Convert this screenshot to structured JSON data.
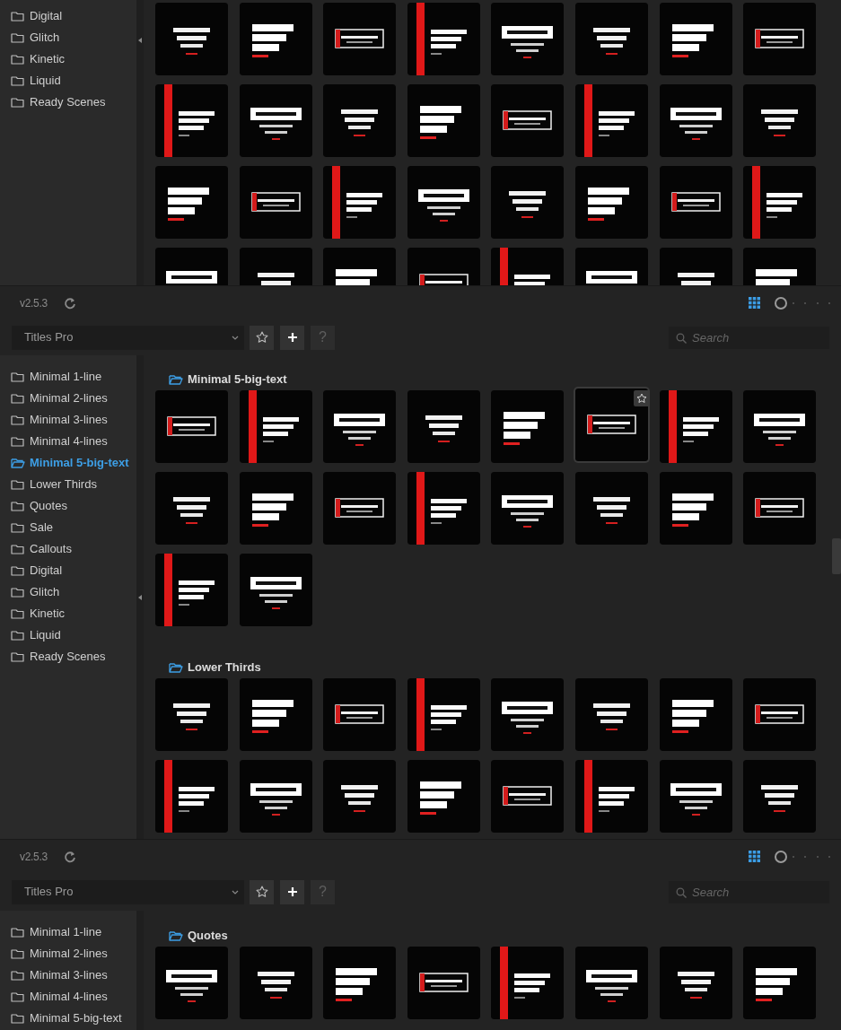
{
  "panels": [
    {
      "sidebar": {
        "items": [
          {
            "label": "Digital",
            "selected": false
          },
          {
            "label": "Glitch",
            "selected": false
          },
          {
            "label": "Kinetic",
            "selected": false
          },
          {
            "label": "Liquid",
            "selected": false
          },
          {
            "label": "Ready Scenes",
            "selected": false
          }
        ]
      },
      "sections": [
        {
          "thumbnails": [
            {
              "kind": "picture"
            },
            {
              "kind": "picture"
            },
            {
              "kind": "picture"
            },
            {
              "kind": "picture"
            },
            {
              "kind": "picture"
            },
            {
              "kind": "picture"
            },
            {
              "kind": "picture"
            },
            {
              "kind": "picture"
            },
            {
              "kind": "picture"
            },
            {
              "kind": "picture"
            },
            {
              "kind": "picture"
            },
            {
              "kind": "picture"
            },
            {
              "kind": "picture"
            },
            {
              "kind": "picture"
            },
            {
              "kind": "picture"
            },
            {
              "kind": "picture"
            },
            {
              "kind": "picture"
            },
            {
              "kind": "picture"
            },
            {
              "kind": "picture"
            },
            {
              "kind": "picture"
            },
            {
              "kind": "picture"
            },
            {
              "kind": "picture"
            },
            {
              "kind": "picture"
            },
            {
              "kind": "picture"
            },
            {
              "kind": "picture"
            },
            {
              "kind": "picture"
            },
            {
              "kind": "picture"
            },
            {
              "kind": "picture"
            },
            {
              "kind": "picture"
            },
            {
              "kind": "picture"
            },
            {
              "kind": "picture"
            },
            {
              "kind": "picture"
            }
          ]
        }
      ]
    },
    {
      "version": "v2.5.3",
      "size_slider": {
        "level": 0
      },
      "library": "Titles Pro",
      "help_label": "?",
      "search": {
        "placeholder": "Search"
      },
      "sidebar": {
        "items": [
          {
            "label": "Minimal 1-line",
            "selected": false
          },
          {
            "label": "Minimal 2-lines",
            "selected": false
          },
          {
            "label": "Minimal 3-lines",
            "selected": false
          },
          {
            "label": "Minimal 4-lines",
            "selected": false
          },
          {
            "label": "Minimal 5-big-text",
            "selected": true
          },
          {
            "label": "Lower Thirds",
            "selected": false
          },
          {
            "label": "Quotes",
            "selected": false
          },
          {
            "label": "Sale",
            "selected": false
          },
          {
            "label": "Callouts",
            "selected": false
          },
          {
            "label": "Digital",
            "selected": false
          },
          {
            "label": "Glitch",
            "selected": false
          },
          {
            "label": "Kinetic",
            "selected": false
          },
          {
            "label": "Liquid",
            "selected": false
          },
          {
            "label": "Ready Scenes",
            "selected": false
          }
        ]
      },
      "sections": [
        {
          "title": "Minimal 5-big-text",
          "thumbnails": [
            {
              "kind": "picture",
              "hovered": false
            },
            {
              "kind": "picture",
              "hovered": false
            },
            {
              "kind": "picture",
              "hovered": false
            },
            {
              "kind": "picture",
              "hovered": false
            },
            {
              "kind": "picture",
              "hovered": false
            },
            {
              "kind": "picture",
              "hovered": true
            },
            {
              "kind": "picture",
              "hovered": false
            },
            {
              "kind": "picture",
              "hovered": false
            },
            {
              "kind": "picture",
              "hovered": false
            },
            {
              "kind": "picture",
              "hovered": false
            },
            {
              "kind": "picture",
              "hovered": false
            },
            {
              "kind": "picture",
              "hovered": false
            },
            {
              "kind": "picture",
              "hovered": false
            },
            {
              "kind": "picture",
              "hovered": false
            },
            {
              "kind": "picture",
              "hovered": false
            },
            {
              "kind": "picture",
              "hovered": false
            },
            {
              "kind": "picture",
              "hovered": false
            },
            {
              "kind": "picture",
              "hovered": false
            }
          ]
        },
        {
          "title": "Lower Thirds",
          "thumbnails": [
            {
              "kind": "picture"
            },
            {
              "kind": "picture"
            },
            {
              "kind": "picture"
            },
            {
              "kind": "picture"
            },
            {
              "kind": "picture"
            },
            {
              "kind": "picture"
            },
            {
              "kind": "picture"
            },
            {
              "kind": "picture"
            },
            {
              "kind": "picture"
            },
            {
              "kind": "picture"
            },
            {
              "kind": "picture"
            },
            {
              "kind": "picture"
            },
            {
              "kind": "picture"
            },
            {
              "kind": "picture"
            },
            {
              "kind": "picture"
            },
            {
              "kind": "picture"
            }
          ]
        }
      ]
    },
    {
      "version": "v2.5.3",
      "size_slider": {
        "level": 0
      },
      "library": "Titles Pro",
      "help_label": "?",
      "search": {
        "placeholder": "Search"
      },
      "sidebar": {
        "items": [
          {
            "label": "Minimal 1-line",
            "selected": false
          },
          {
            "label": "Minimal 2-lines",
            "selected": false
          },
          {
            "label": "Minimal 3-lines",
            "selected": false
          },
          {
            "label": "Minimal 4-lines",
            "selected": false
          },
          {
            "label": "Minimal 5-big-text",
            "selected": false
          }
        ]
      },
      "sections": [
        {
          "title": "Quotes",
          "thumbnails": [
            {
              "kind": "picture"
            },
            {
              "kind": "picture"
            },
            {
              "kind": "picture"
            },
            {
              "kind": "picture"
            },
            {
              "kind": "picture"
            },
            {
              "kind": "picture"
            },
            {
              "kind": "picture"
            },
            {
              "kind": "picture"
            }
          ]
        }
      ]
    }
  ]
}
